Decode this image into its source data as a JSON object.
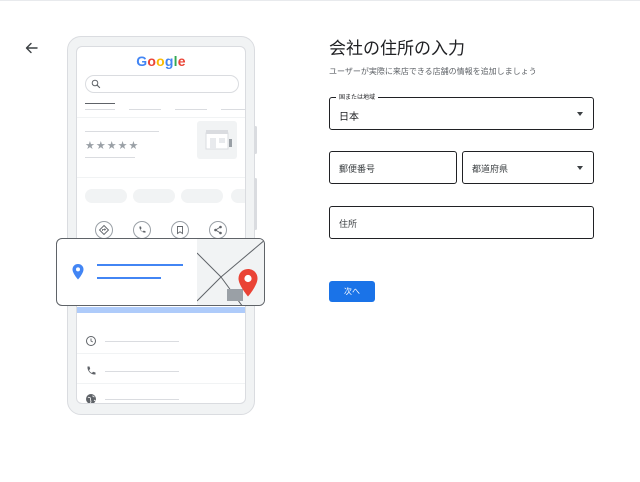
{
  "illustration": {
    "logo": {
      "letters": [
        "G",
        "o",
        "o",
        "g",
        "l",
        "e"
      ]
    },
    "stars": "★★★★★"
  },
  "form": {
    "title": "会社の住所の入力",
    "subtitle": "ユーザーが実際に来店できる店舗の情報を追加しましょう",
    "country": {
      "label": "国または地域",
      "value": "日本"
    },
    "postal_code": {
      "placeholder": "郵便番号",
      "value": ""
    },
    "prefecture": {
      "placeholder": "都道府県",
      "value": ""
    },
    "address": {
      "placeholder": "住所",
      "value": ""
    },
    "next_label": "次へ"
  },
  "colors": {
    "primary": "#1a73e8",
    "google_blue": "#4285f4",
    "google_red": "#ea4335",
    "google_yellow": "#fbbc05",
    "google_green": "#34a853"
  },
  "icons": [
    "back-arrow-icon",
    "search-icon",
    "directions-icon",
    "phone-icon",
    "bookmark-icon",
    "share-icon",
    "location-pin-icon",
    "map-pin-icon",
    "clock-icon",
    "globe-icon",
    "dropdown-caret-icon"
  ]
}
